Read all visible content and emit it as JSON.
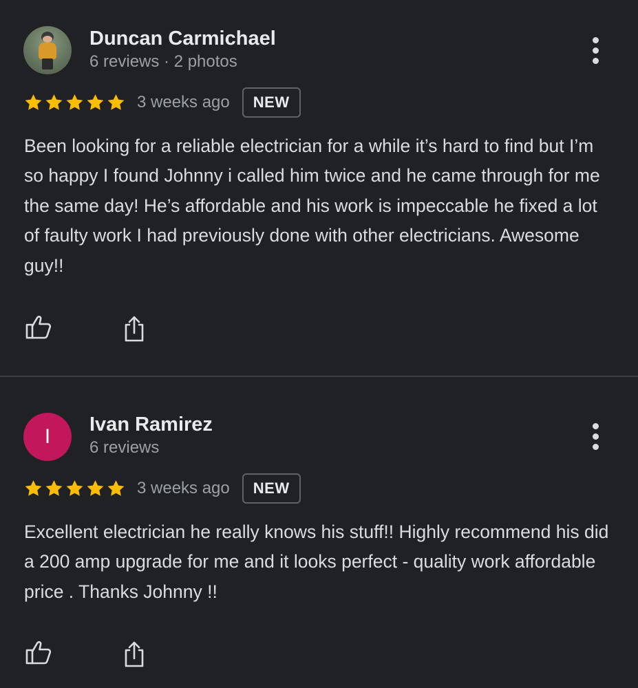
{
  "reviews": [
    {
      "author": "Duncan Carmichael",
      "meta": "6 reviews · 2 photos",
      "rating": 5,
      "rating_max": 5,
      "date": "3 weeks ago",
      "badge": "NEW",
      "avatar": "photo",
      "text": "Been looking for a reliable electrician for a while it’s hard to find but I’m so happy I found Johnny i called him twice and he came through for me the same day! He’s affordable and his work is impeccable he fixed a lot of faulty work I had previously done with other electricians. Awesome guy!!"
    },
    {
      "author": "Ivan Ramirez",
      "meta": "6 reviews",
      "rating": 5,
      "rating_max": 5,
      "date": "3 weeks ago",
      "badge": "NEW",
      "avatar_letter": "I",
      "avatar_color": "#c2185b",
      "text": "Excellent electrician he really knows his stuff!! Highly recommend his did a 200 amp upgrade for me and it looks perfect - quality work affordable price . Thanks Johnny !!"
    }
  ],
  "icons": {
    "more": "more-vert-icon",
    "like": "thumbs-up-icon",
    "share": "share-icon",
    "star": "star-icon"
  },
  "colors": {
    "background": "#202124",
    "star": "#fbbc04",
    "divider": "#3c4043"
  }
}
